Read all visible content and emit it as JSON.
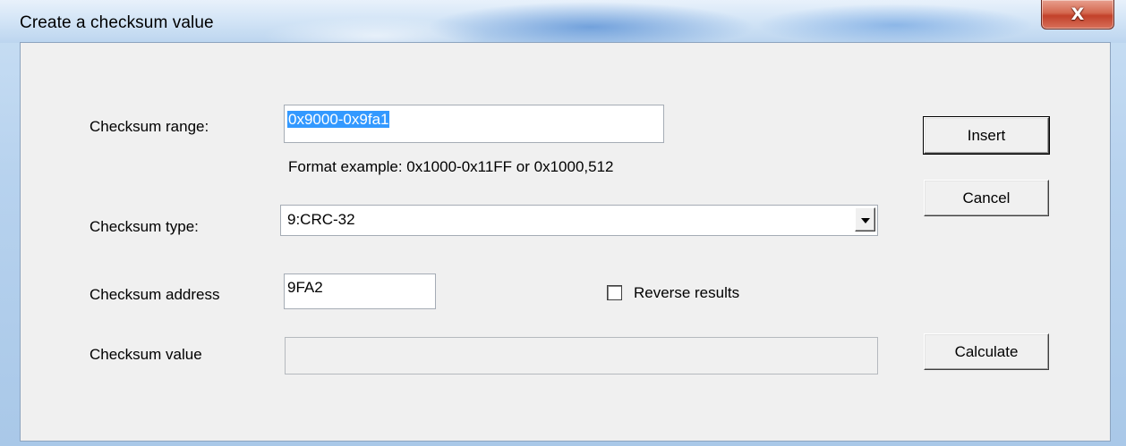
{
  "window": {
    "title": "Create a checksum value",
    "close_glyph": "X"
  },
  "form": {
    "range_label": "Checksum range:",
    "range_value": "0x9000-0x9fa1",
    "format_hint": "Format example: 0x1000-0x11FF or 0x1000,512",
    "type_label": "Checksum type:",
    "type_value": "9:CRC-32",
    "address_label": "Checksum address",
    "address_value": "9FA2",
    "reverse_label": "Reverse results",
    "reverse_checked": false,
    "value_label": "Checksum value",
    "value_value": ""
  },
  "buttons": {
    "insert": "Insert",
    "cancel": "Cancel",
    "calculate": "Calculate"
  },
  "icons": {
    "close": "close-icon",
    "dropdown": "chevron-down-icon"
  },
  "colors": {
    "selection": "#3399ff",
    "dialog_bg": "#f0f0f0",
    "close_button": "#c2412a"
  }
}
